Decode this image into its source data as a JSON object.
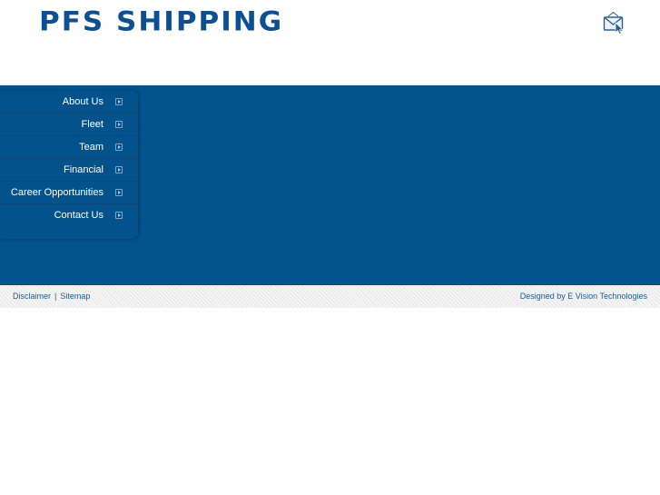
{
  "header": {
    "logo_text": "PFS SHIPPING",
    "mail_icon": "envelope-cursor-icon"
  },
  "nav": {
    "items": [
      {
        "label": "About Us",
        "icon": "arrow-box-icon"
      },
      {
        "label": "Fleet",
        "icon": "arrow-box-icon"
      },
      {
        "label": "Team",
        "icon": "arrow-box-icon"
      },
      {
        "label": "Financial",
        "icon": "arrow-box-icon"
      },
      {
        "label": "Career Opportunities",
        "icon": "arrow-box-icon"
      },
      {
        "label": "Contact Us",
        "icon": "arrow-box-icon"
      }
    ]
  },
  "footer": {
    "disclaimer": "Disclaimer",
    "separator": "|",
    "sitemap": "Sitemap",
    "credit": "Designed by E Vision Technologies"
  },
  "colors": {
    "brand_blue": "#0d4f93",
    "band_blue": "#02548f",
    "footer_link": "#1f5b8f"
  }
}
